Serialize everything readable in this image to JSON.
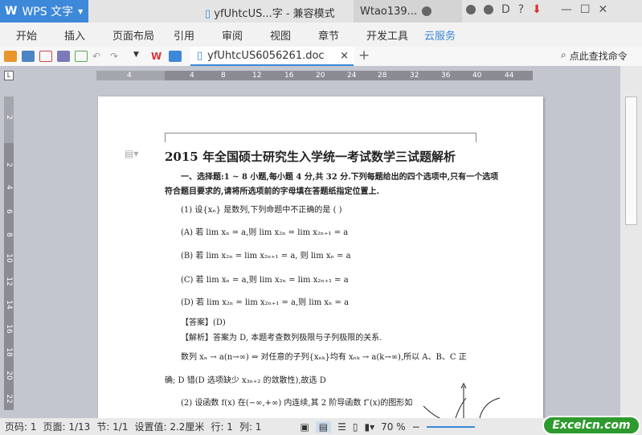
{
  "titlebar": {
    "app": "WPS 文字",
    "doc_title": "yfUhtcUS...字 - 兼容模式",
    "user": "Wtao139..."
  },
  "menu": [
    "开始",
    "插入",
    "页面布局",
    "引用",
    "审阅",
    "视图",
    "章节",
    "开发工具",
    "云服务"
  ],
  "tab": {
    "name": "yfUhtcUS6056261.doc",
    "close": "×",
    "add": "+"
  },
  "search": "点此查找命令",
  "ruler": {
    "h": [
      "4",
      "4",
      "8",
      "12",
      "16",
      "20",
      "24",
      "28",
      "32",
      "36",
      "40",
      "44"
    ],
    "v": [
      "2",
      "2",
      "4",
      "6",
      "8",
      "10",
      "12",
      "14",
      "16",
      "18",
      "20",
      "22"
    ]
  },
  "doc": {
    "title": "2015 年全国硕士研究生入学统一考试数学三试题解析",
    "intro1": "一、选择题:1 ~ 8 小题,每小题 4 分,共 32 分.下列每题给出的四个选项中,只有一个选项",
    "intro2": "符合题目要求的,请将所选项前的字母填在答题纸指定位置上.",
    "q1": "(1) 设{xₙ} 是数列,下列命题中不正确的是 (    )",
    "a": "(A) 若 lim xₙ = a,则  lim x₂ₙ = lim x₂ₙ₊₁ = a",
    "b": "(B) 若 lim x₂ₙ = lim x₂ₙ₊₁ = a, 则 lim xₙ = a",
    "cc": "(C) 若 lim xₙ = a,则  lim x₂ₙ = lim x₂ₙ₊₁ = a",
    "d": "(D) 若 lim x₂ₙ = lim x₂ₙ₊₁ = a,则 lim xₙ = a",
    "answer": "【答案】(D)",
    "analysis": "【解析】答案为 D, 本题考查数列极限与子列极限的关系.",
    "line1": "数列 xₙ → a(n→∞) ⇔ 对任意的子列{xₙₖ}均有 xₙₖ → a(k→∞),所以 A、B、C 正",
    "line2": "确;  D 错(D 选项缺少 x₃ₙ₊₂ 的敛散性),故选 D",
    "q2": "(2)  设函数 f(x) 在(−∞,+∞) 内连续,其 2 阶导函数 f″(x)的图形如"
  },
  "status": {
    "page": "页码: 1",
    "pages": "页面: 1/13",
    "section": "节: 1/1",
    "setting": "设置值: 2.2厘米",
    "row": "行: 1",
    "col": "列: 1",
    "zoom": "70 %"
  },
  "watermark": "Excelcn.com"
}
